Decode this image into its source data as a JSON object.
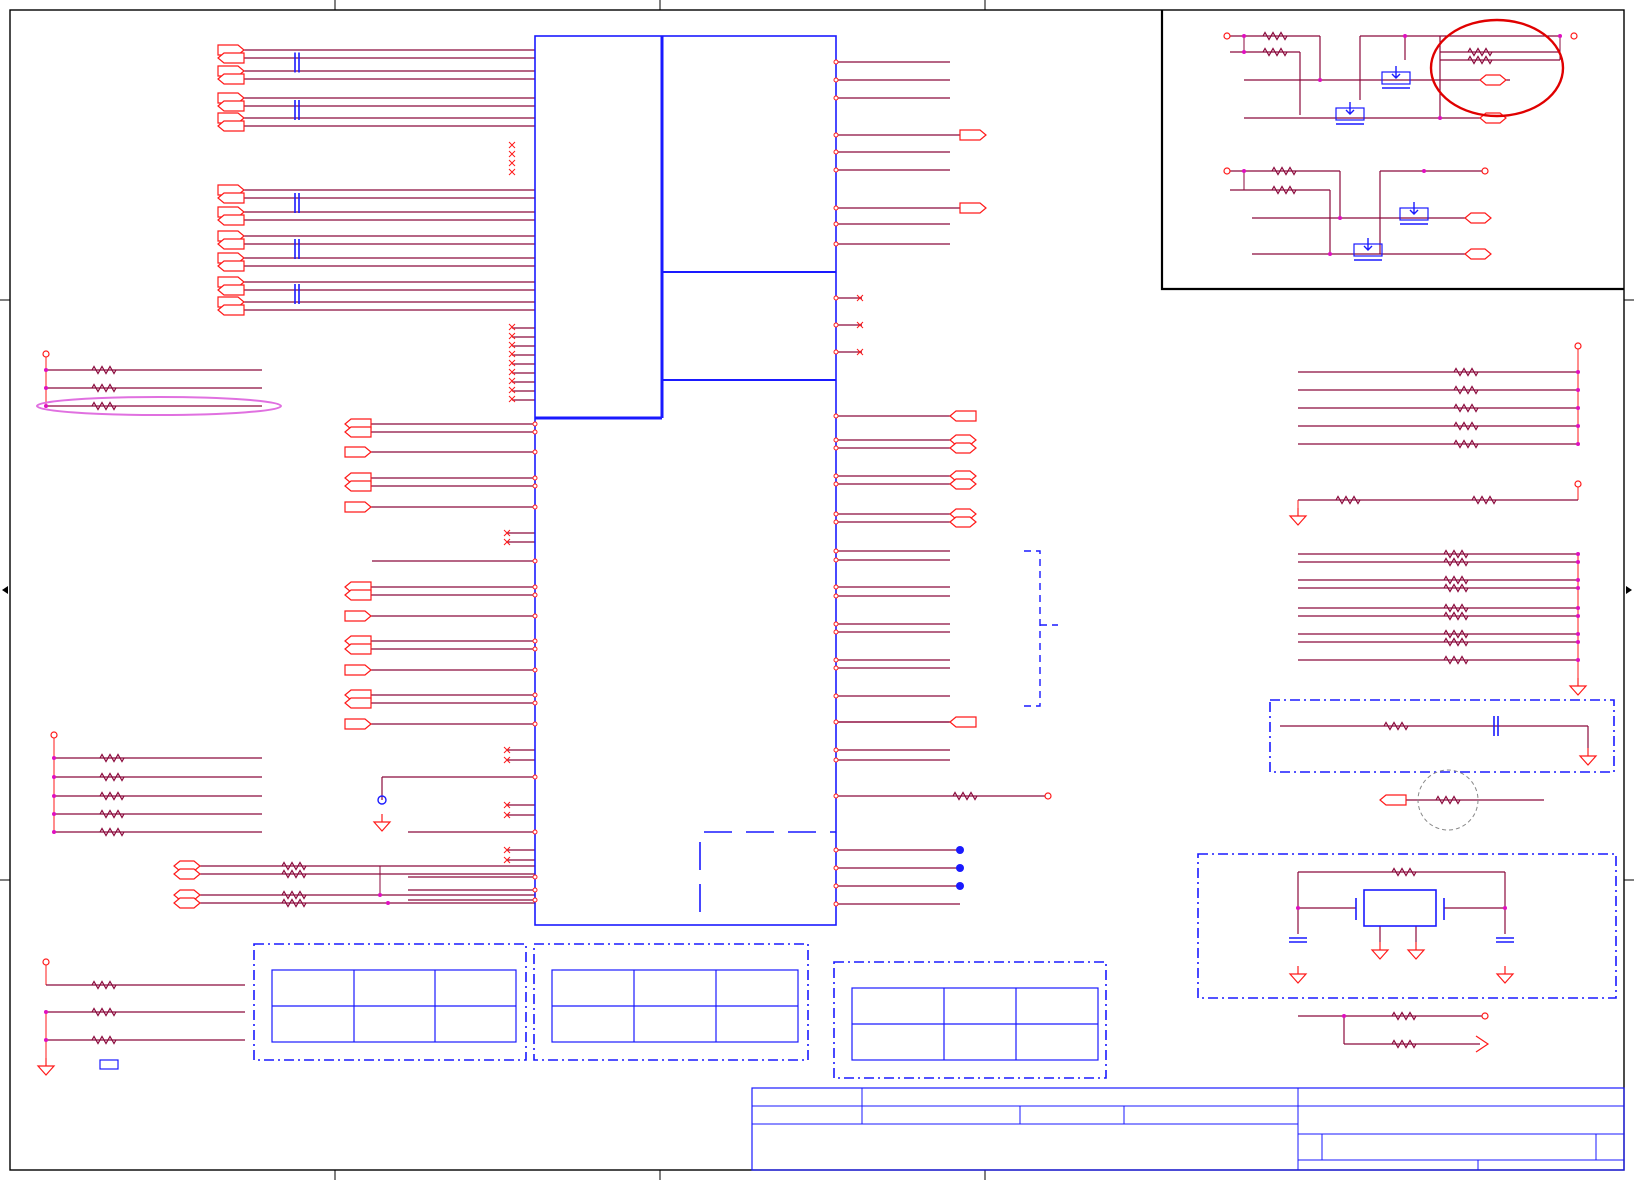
{
  "sheet": {
    "title_block_rows": 3
  },
  "colors": {
    "wire": "#8b0a3c",
    "port": "#ff1a1a",
    "part": "#1a1aff",
    "node": "#e010c0",
    "frame": "#000000",
    "highlight_red": "#e00000",
    "highlight_pink": "#e070e0"
  },
  "components": {
    "resistor_icon": "zigzag-resistor",
    "capacitor_icon": "parallel-plate-capacitor",
    "mosfet_icon": "n-channel-mosfet",
    "ground_icon": "ground-triangle",
    "port_icon": "off-page-connector",
    "crystal_icon": "crystal-oscillator"
  }
}
